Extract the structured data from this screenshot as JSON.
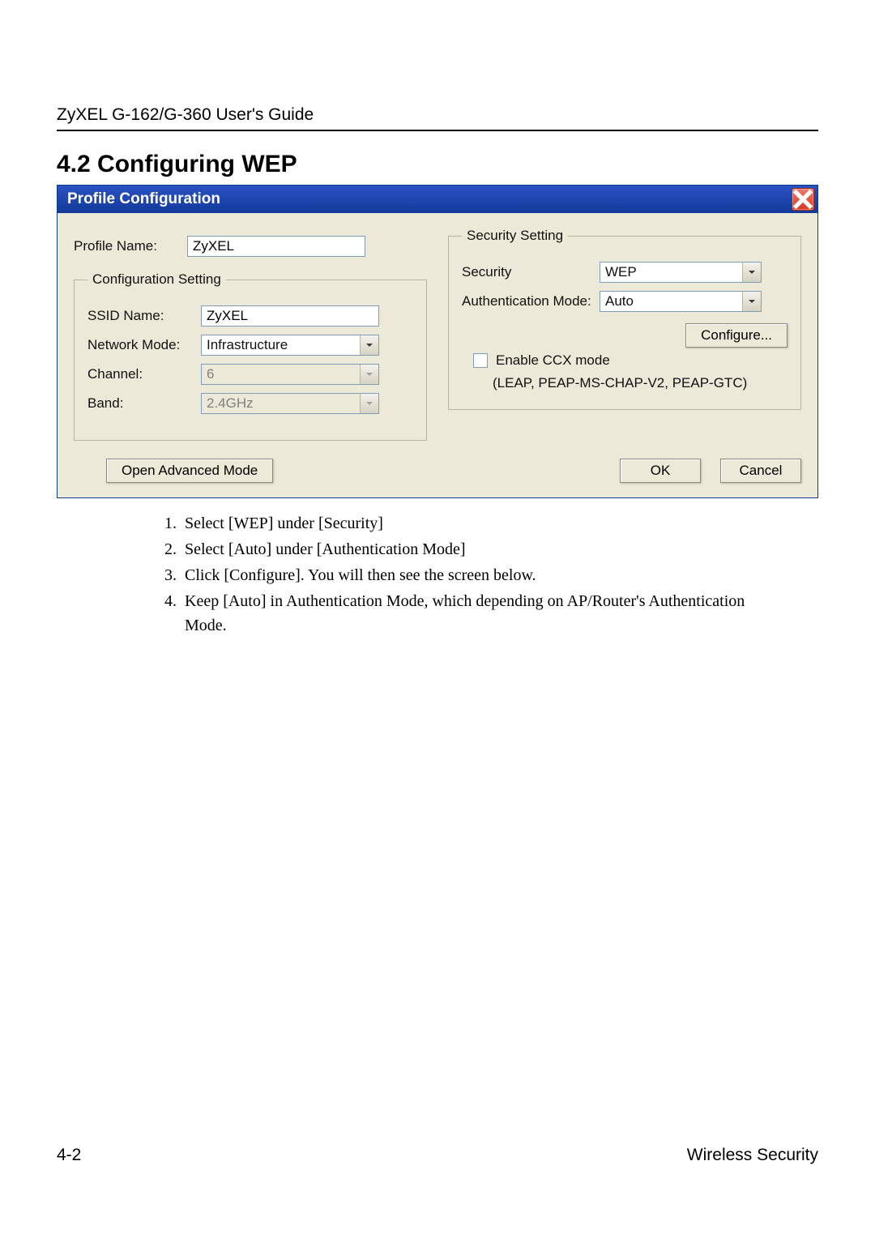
{
  "doc_header": "ZyXEL G-162/G-360 User's Guide",
  "section_title": "4.2   Configuring WEP",
  "dialog": {
    "title": "Profile Configuration",
    "profile_name_label": "Profile Name:",
    "profile_name_value": "ZyXEL",
    "config_legend": "Configuration Setting",
    "ssid_label": "SSID Name:",
    "ssid_value": "ZyXEL",
    "network_mode_label": "Network Mode:",
    "network_mode_value": "Infrastructure",
    "channel_label": "Channel:",
    "channel_value": "6",
    "band_label": "Band:",
    "band_value": "2.4GHz",
    "security_legend": "Security Setting",
    "security_label": "Security",
    "security_value": "WEP",
    "auth_label": "Authentication Mode:",
    "auth_value": "Auto",
    "configure_btn": "Configure...",
    "ccx_label": "Enable CCX mode",
    "ccx_note": "(LEAP, PEAP-MS-CHAP-V2, PEAP-GTC)",
    "advanced_btn": "Open Advanced Mode",
    "ok_btn": "OK",
    "cancel_btn": "Cancel"
  },
  "instructions": [
    "Select [WEP] under [Security]",
    "Select [Auto] under [Authentication Mode]",
    "Click [Configure].  You will then see the screen below.",
    "Keep [Auto] in Authentication Mode, which depending on AP/Router's Authentication Mode."
  ],
  "footer_left": "4-2",
  "footer_right": "Wireless Security"
}
